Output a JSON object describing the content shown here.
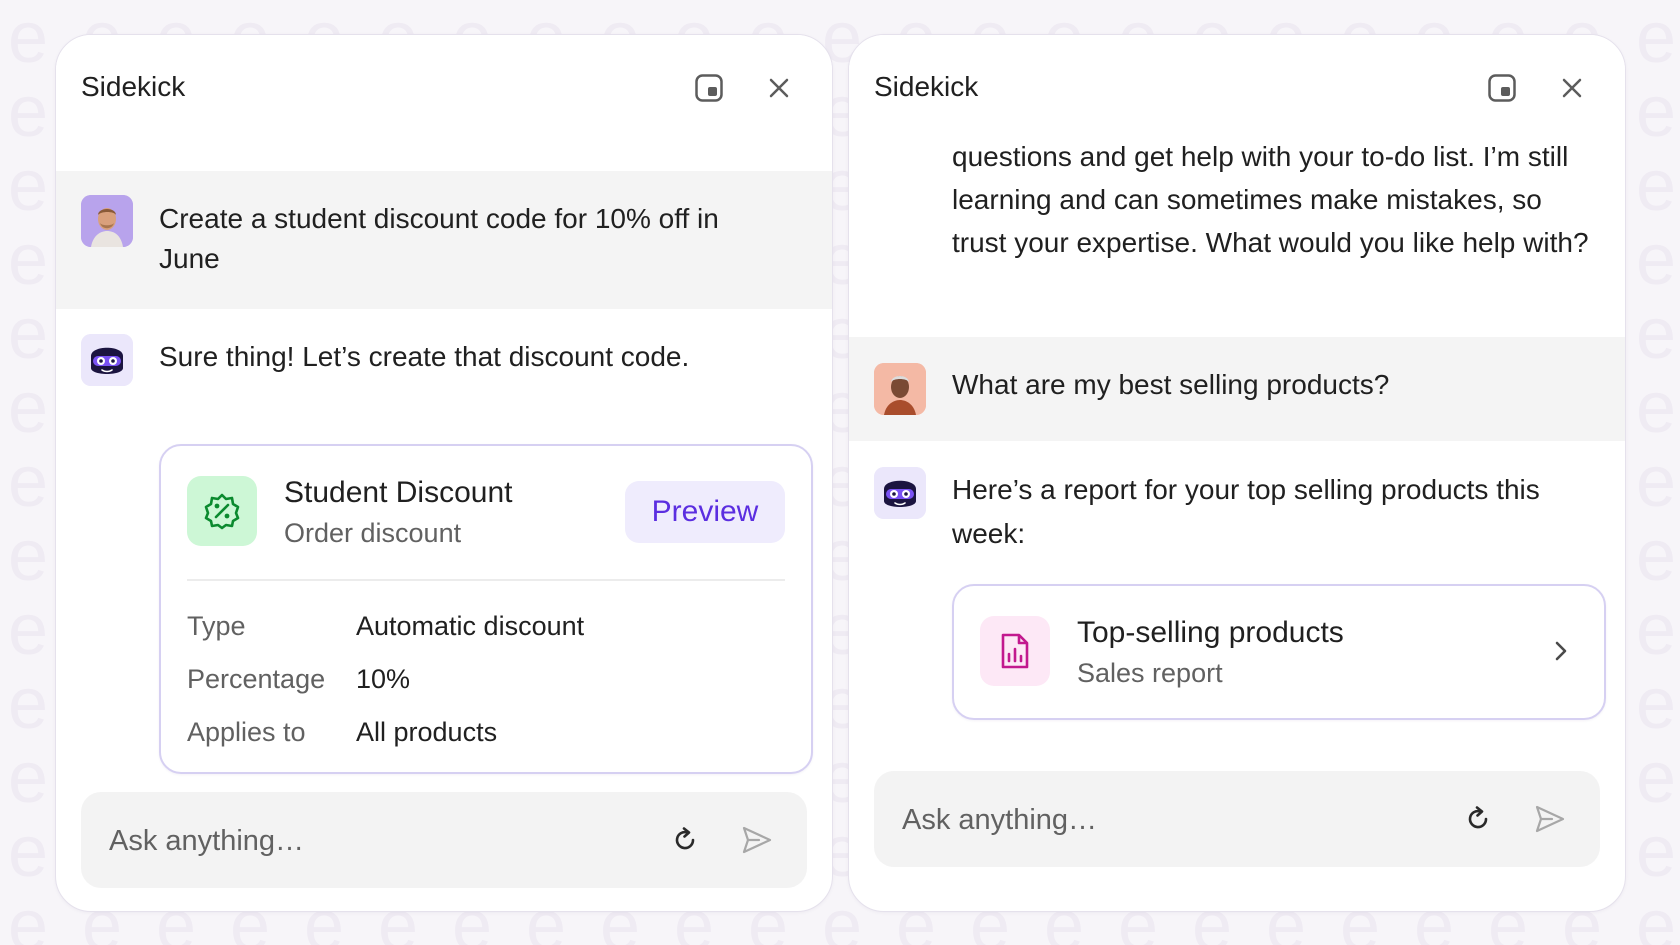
{
  "colors": {
    "accent": "#5b2ee0",
    "card_border": "#d6d0f2",
    "discount_icon_bg": "#cdf7d6",
    "discount_icon": "#0b8a2f",
    "report_icon_bg": "#fde8f6",
    "report_icon": "#c2188e",
    "user_row_bg": "#f4f4f4"
  },
  "left_panel": {
    "title": "Sidekick",
    "icons": {
      "dock": "dock-window-icon",
      "close": "close-icon"
    },
    "user_message": {
      "avatar": "user-avatar-man",
      "text": "Create a student discount code for 10% off in June"
    },
    "assistant_message": {
      "avatar": "sidekick-bot-avatar",
      "text": "Sure thing! Let’s create that discount code.",
      "card": {
        "icon": "discount-badge-icon",
        "title": "Student Discount",
        "subtitle": "Order discount",
        "preview_label": "Preview",
        "rows": [
          {
            "label": "Type",
            "value": "Automatic discount"
          },
          {
            "label": "Percentage",
            "value": "10%"
          },
          {
            "label": "Applies to",
            "value": "All products"
          }
        ]
      }
    },
    "input": {
      "placeholder": "Ask anything…",
      "value": ""
    }
  },
  "right_panel": {
    "title": "Sidekick",
    "icons": {
      "dock": "dock-window-icon",
      "close": "close-icon"
    },
    "intro_text": "questions and get help with your to-do list. I’m still learning and can sometimes make mistakes, so trust your expertise. What would you like help with?",
    "user_message": {
      "avatar": "user-avatar-woman",
      "text": "What are my best selling products?"
    },
    "assistant_message": {
      "avatar": "sidekick-bot-avatar",
      "text": "Here’s a report for your top selling products this week:",
      "card": {
        "icon": "report-chart-icon",
        "title": "Top-selling products",
        "subtitle": "Sales report",
        "chevron": "chevron-right-icon"
      }
    },
    "input": {
      "placeholder": "Ask anything…",
      "value": ""
    }
  }
}
